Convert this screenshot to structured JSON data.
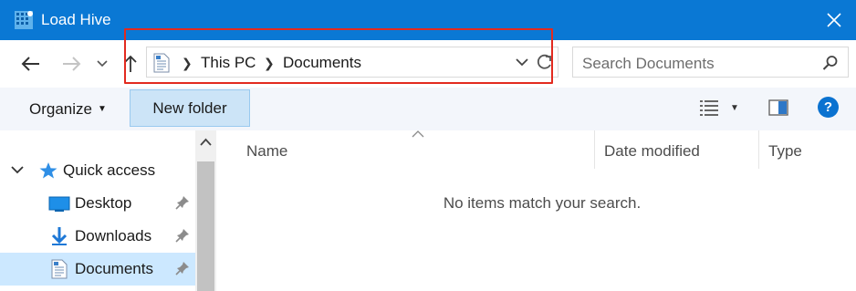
{
  "window": {
    "title": "Load Hive"
  },
  "address": {
    "crumbs": [
      "This PC",
      "Documents"
    ]
  },
  "search": {
    "placeholder": "Search Documents"
  },
  "toolbar": {
    "organize_label": "Organize",
    "new_folder_label": "New folder"
  },
  "nav_tree": {
    "items": [
      {
        "label": "Quick access",
        "icon": "star-icon",
        "expanded": true
      },
      {
        "label": "Desktop",
        "icon": "desktop-icon",
        "pinned": true
      },
      {
        "label": "Downloads",
        "icon": "download-arrow-icon",
        "pinned": true
      },
      {
        "label": "Documents",
        "icon": "document-icon",
        "pinned": true,
        "selected": true
      }
    ]
  },
  "columns": [
    "Name",
    "Date modified",
    "Type"
  ],
  "empty_message": "No items match your search.",
  "colors": {
    "titlebar": "#0a78d4",
    "highlight_border": "#e22a1f",
    "selection": "#cce8ff",
    "new_folder_bg": "#cce4f7"
  }
}
